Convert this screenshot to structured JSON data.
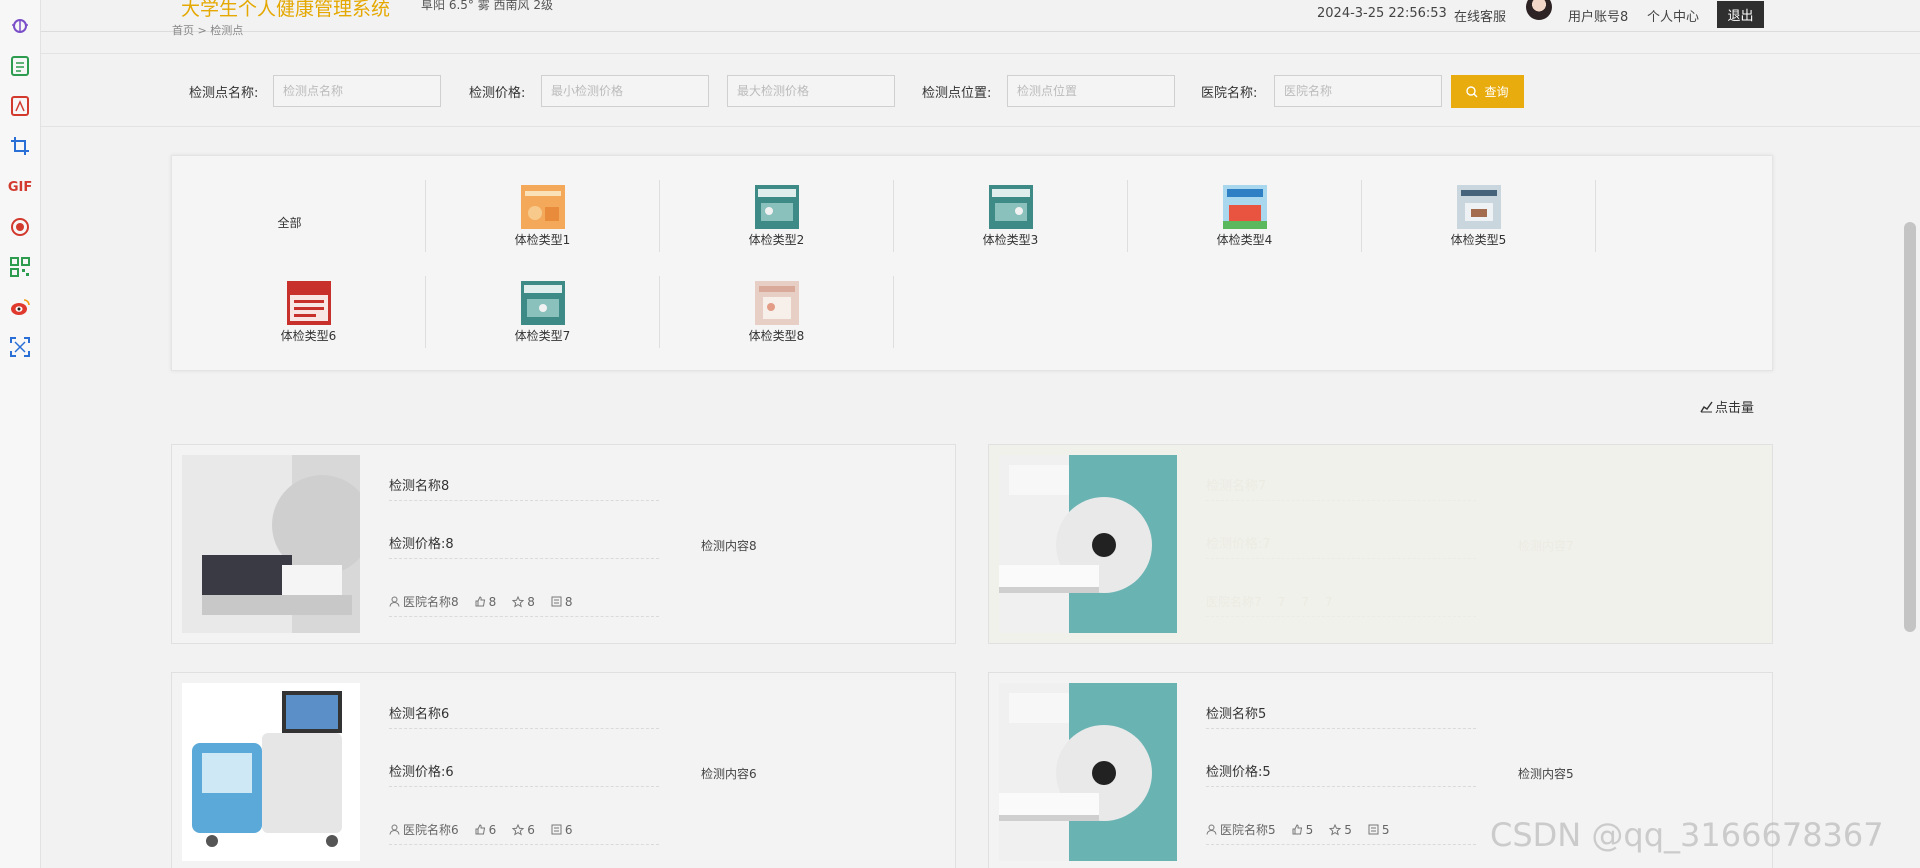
{
  "header": {
    "system_title": "大学生个人健康管理系统",
    "weather": "阜阳 6.5° 雾 西南风 2级",
    "datetime": "2024-3-25 22:56:53",
    "online_service": "在线客服",
    "user_account": "用户账号8",
    "personal_center": "个人中心",
    "logout": "退出"
  },
  "breadcrumb": {
    "home": "首页",
    "sep": ">",
    "current": "检测点"
  },
  "search": {
    "name_label": "检测点名称:",
    "name_placeholder": "检测点名称",
    "price_label": "检测价格:",
    "min_price_placeholder": "最小检测价格",
    "max_price_placeholder": "最大检测价格",
    "location_label": "检测点位置:",
    "location_placeholder": "检测点位置",
    "hospital_label": "医院名称:",
    "hospital_placeholder": "医院名称",
    "query_button": "查询"
  },
  "categories": {
    "all": "全部",
    "items": [
      "体检类型1",
      "体检类型2",
      "体检类型3",
      "体检类型4",
      "体检类型5",
      "体检类型6",
      "体检类型7",
      "体检类型8"
    ]
  },
  "sort": {
    "clicks_label": "点击量"
  },
  "cards": [
    {
      "name": "检测名称8",
      "price": "检测价格:8",
      "content": "检测内容8",
      "hospital": "医院名称8",
      "likes": "8",
      "favorites": "8",
      "comments": "8"
    },
    {
      "name": "检测名称7",
      "price": "检测价格:7",
      "content": "检测内容7",
      "hospital": "医院名称7",
      "likes": "7",
      "favorites": "7",
      "comments": "7"
    },
    {
      "name": "检测名称6",
      "price": "检测价格:6",
      "content": "检测内容6",
      "hospital": "医院名称6",
      "likes": "6",
      "favorites": "6",
      "comments": "6"
    },
    {
      "name": "检测名称5",
      "price": "检测价格:5",
      "content": "检测内容5",
      "hospital": "医院名称5",
      "likes": "5",
      "favorites": "5",
      "comments": "5"
    }
  ],
  "watermark": "CSDN @qq_3166678367",
  "colors": {
    "accent": "#e9ac0e",
    "title": "#e5a800",
    "logout_bg": "#2f2f2f"
  }
}
